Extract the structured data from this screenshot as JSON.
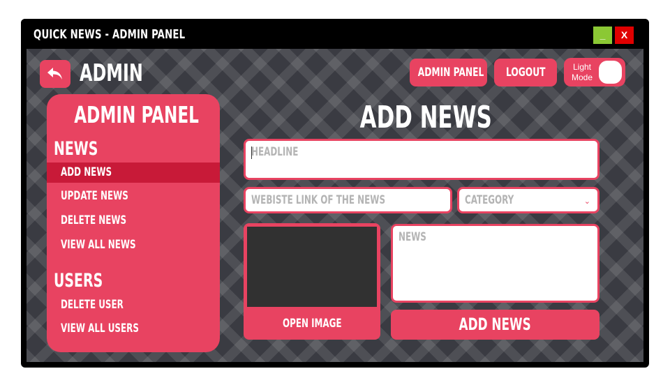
{
  "window": {
    "title": "QUICK NEWS - ADMIN PANEL",
    "minimize_label": "_",
    "close_label": "X",
    "colors": {
      "minimize": "#8bc834",
      "close": "#e00000"
    }
  },
  "header": {
    "section_label": "ADMIN",
    "back_icon": "back-arrow-icon",
    "admin_panel_button": "ADMIN PANEL",
    "logout_button": "LOGOUT",
    "mode_toggle_label": "Light Mode"
  },
  "sidebar": {
    "title": "ADMIN PANEL",
    "sections": [
      {
        "label": "NEWS",
        "items": [
          {
            "label": "ADD NEWS",
            "active": true
          },
          {
            "label": "UPDATE NEWS",
            "active": false
          },
          {
            "label": "DELETE NEWS",
            "active": false
          },
          {
            "label": "VIEW ALL NEWS",
            "active": false
          }
        ]
      },
      {
        "label": "USERS",
        "items": [
          {
            "label": "DELETE USER",
            "active": false
          },
          {
            "label": "VIEW ALL USERS",
            "active": false
          }
        ]
      }
    ]
  },
  "form": {
    "title": "ADD NEWS",
    "headline_placeholder": "HEADLINE",
    "website_placeholder": "WEBISTE LINK OF THE NEWS",
    "category_placeholder": "CATEGORY",
    "news_placeholder": "NEWS",
    "open_image_button": "OPEN IMAGE",
    "submit_button": "ADD NEWS"
  },
  "colors": {
    "accent": "#e84361",
    "accent_active": "#c81a38",
    "background": "#3a3b42",
    "image_placeholder": "#313131"
  }
}
